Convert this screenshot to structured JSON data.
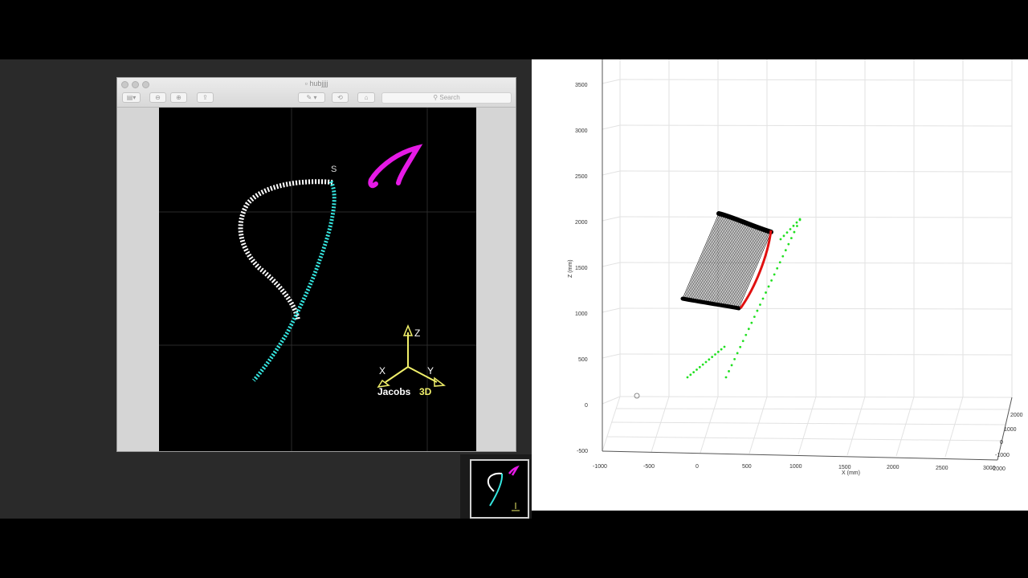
{
  "preview_window": {
    "title": "hubjjjj",
    "search_placeholder": "Search",
    "toolbar": {
      "sidebar_icon": "sidebar-icon",
      "zoom_out_icon": "zoom-out-icon",
      "zoom_in_icon": "zoom-in-icon",
      "share_icon": "share-icon",
      "markup_icon": "pen-icon",
      "rotate_icon": "rotate-icon",
      "toolbox_icon": "toolbox-icon"
    },
    "image": {
      "start_marker": "S",
      "axis_z": "Z",
      "axis_x": "X",
      "axis_y": "Y",
      "logo_text": "Jacobs",
      "logo_accent": "3D",
      "colors": {
        "white_trace": "#ffffff",
        "cyan_trace": "#35e6e0",
        "magenta_trace": "#e61ae6",
        "axis_yellow": "#f0ef6a",
        "logo_accent": "#f0ef6a"
      }
    }
  },
  "plot": {
    "z_ticks": [
      "3500",
      "3000",
      "2500",
      "2000",
      "1500",
      "1000",
      "500",
      "0",
      "-500"
    ],
    "z_label": "Z (mm)",
    "x_ticks": [
      "-1000",
      "-500",
      "0",
      "500",
      "1000",
      "1500",
      "2000",
      "2500",
      "3000"
    ],
    "x_label": "X (mm)",
    "y_ticks": [
      "2000",
      "1000",
      "0",
      "-1000",
      "-2000"
    ],
    "colors": {
      "black_path": "#000000",
      "red_path": "#e01010",
      "green_points": "#22e022"
    }
  }
}
